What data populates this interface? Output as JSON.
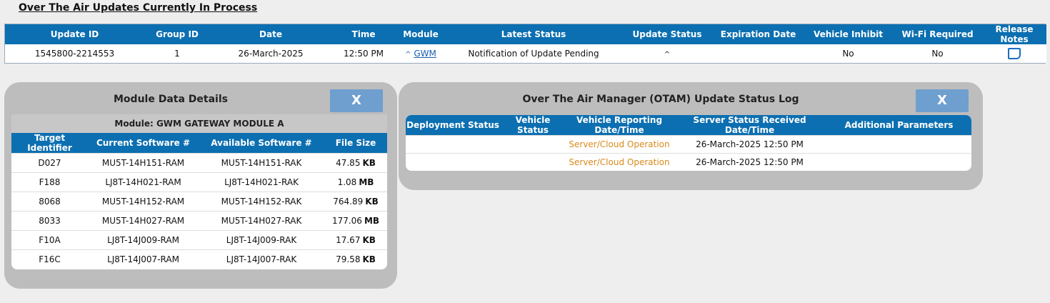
{
  "page_title": "Over The Air Updates Currently In Process",
  "ota_table": {
    "headers": [
      "Update ID",
      "Group ID",
      "Date",
      "Time",
      "Module",
      "Latest Status",
      "Update Status",
      "Expiration Date",
      "Vehicle Inhibit",
      "Wi-Fi Required",
      "Release Notes"
    ],
    "row": {
      "update_id": "1545800-2214553",
      "group_id": "1",
      "date": "26-March-2025",
      "time": "12:50 PM",
      "module_caret": "^",
      "module": "GWM",
      "latest_status": "Notification of Update Pending",
      "update_status": "^",
      "expiration_date": "",
      "vehicle_inhibit": "No",
      "wifi_required": "No",
      "release_notes_icon": "note-icon"
    }
  },
  "module_panel": {
    "title": "Module Data Details",
    "close_label": "X",
    "subtitle": "Module: GWM GATEWAY MODULE A",
    "headers": [
      "Target Identifier",
      "Current Software #",
      "Available Software #",
      "File Size"
    ],
    "rows": [
      {
        "target": "D027",
        "current": "MU5T-14H151-RAM",
        "available": "MU5T-14H151-RAK",
        "size": "47.85",
        "unit": "KB"
      },
      {
        "target": "F188",
        "current": "LJ8T-14H021-RAM",
        "available": "LJ8T-14H021-RAK",
        "size": "1.08",
        "unit": "MB"
      },
      {
        "target": "8068",
        "current": "MU5T-14H152-RAM",
        "available": "MU5T-14H152-RAK",
        "size": "764.89",
        "unit": "KB"
      },
      {
        "target": "8033",
        "current": "MU5T-14H027-RAM",
        "available": "MU5T-14H027-RAK",
        "size": "177.06",
        "unit": "MB"
      },
      {
        "target": "F10A",
        "current": "LJ8T-14J009-RAM",
        "available": "LJ8T-14J009-RAK",
        "size": "17.67",
        "unit": "KB"
      },
      {
        "target": "F16C",
        "current": "LJ8T-14J007-RAM",
        "available": "LJ8T-14J007-RAK",
        "size": "79.58",
        "unit": "KB"
      }
    ]
  },
  "otam_panel": {
    "title": "Over The Air Manager (OTAM) Update Status Log",
    "close_label": "X",
    "headers": [
      "Deployment Status",
      "Vehicle Status",
      "Vehicle Reporting Date/Time",
      "Server Status Received Date/Time",
      "Additional Parameters"
    ],
    "rows": [
      {
        "deployment": "",
        "vehicle": "",
        "reporting": "Server/Cloud Operation",
        "received": "26-March-2025 12:50 PM",
        "params": ""
      },
      {
        "deployment": "",
        "vehicle": "",
        "reporting": "Server/Cloud Operation",
        "received": "26-March-2025 12:50 PM",
        "params": ""
      }
    ]
  },
  "colors": {
    "header_blue": "#0c6fb1",
    "close_blue": "#6f9fcf",
    "panel_gray": "#bdbdbd",
    "orange_text": "#d98a1c",
    "link_blue": "#1a5fb0"
  }
}
